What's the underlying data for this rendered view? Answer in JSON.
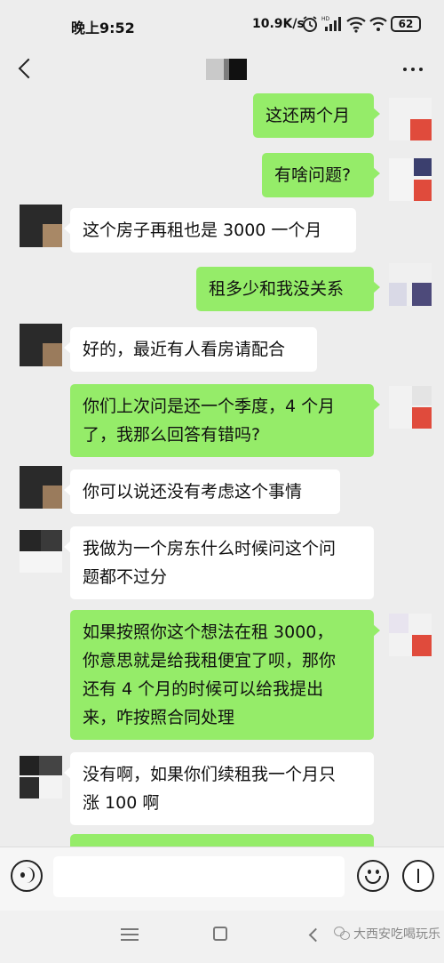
{
  "status_bar": {
    "time": "晚上9:52",
    "network_speed": "10.9K/s",
    "battery": "62",
    "icons": [
      "alarm-icon",
      "hd-signal-icon",
      "wifi-icon",
      "battery-icon"
    ]
  },
  "nav": {
    "back_icon": "chevron-left-icon",
    "more_icon": "more-icon"
  },
  "messages": [
    {
      "side": "right",
      "text": "这还两个月"
    },
    {
      "side": "right",
      "text": "有啥问题?"
    },
    {
      "side": "left",
      "text": "这个房子再租也是 3000 一个月"
    },
    {
      "side": "right",
      "text": "租多少和我没关系"
    },
    {
      "side": "left",
      "text": "好的，最近有人看房请配合"
    },
    {
      "side": "right",
      "text": "你们上次问是还一个季度，4 个月\n了，我那么回答有错吗?"
    },
    {
      "side": "left",
      "text": "你可以说还没有考虑这个事情"
    },
    {
      "side": "left",
      "text": "我做为一个房东什么时候问这个问\n题都不过分"
    },
    {
      "side": "right",
      "text": "如果按照你这个想法在租 3000，\n你意思就是给我租便宜了呗，那你\n还有 4 个月的时候可以给我提出\n来，咋按照合同处理"
    },
    {
      "side": "left",
      "text": "没有啊，如果你们续租我一个月只\n涨 100 啊"
    },
    {
      "side": "right",
      "text": ""
    }
  ],
  "input_bar": {
    "voice_icon": "voice-icon",
    "emoji_icon": "emoji-icon",
    "plus_icon": "plus-icon",
    "text_value": ""
  },
  "system_nav": {
    "watermark": "大西安吃喝玩乐"
  },
  "colors": {
    "background": "#ededed",
    "sent_bubble": "#95ec69",
    "received_bubble": "#ffffff"
  }
}
